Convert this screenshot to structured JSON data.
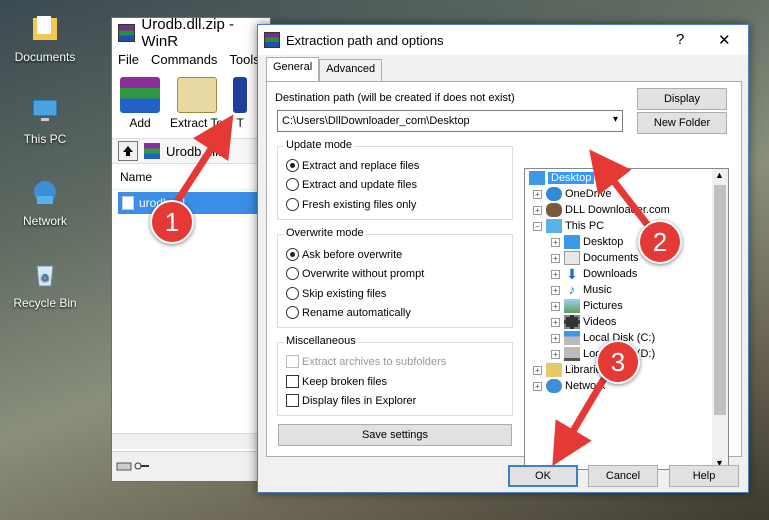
{
  "desktop": {
    "icons": [
      {
        "label": "Documents"
      },
      {
        "label": "This PC"
      },
      {
        "label": "Network"
      },
      {
        "label": "Recycle Bin"
      }
    ]
  },
  "winrar": {
    "title": "Urodb.dll.zip - WinR",
    "menu": [
      "File",
      "Commands",
      "Tools"
    ],
    "tools": [
      {
        "label": "Add",
        "icon": "add-archive-icon"
      },
      {
        "label": "Extract To",
        "icon": "extract-to-icon"
      },
      {
        "label": "T",
        "icon": "test-icon"
      }
    ],
    "path_text": "Urodb.dll.z",
    "column_name": "Name",
    "file_row": "urodb.dll"
  },
  "dialog": {
    "title": "Extraction path and options",
    "help_glyph": "?",
    "close_glyph": "✕",
    "tabs": [
      "General",
      "Advanced"
    ],
    "dest_label": "Destination path (will be created if does not exist)",
    "dest_value": "C:\\Users\\DllDownloader_com\\Desktop",
    "display_btn": "Display",
    "new_folder_btn": "New Folder",
    "update_mode": {
      "title": "Update mode",
      "options": [
        "Extract and replace files",
        "Extract and update files",
        "Fresh existing files only"
      ],
      "selected": 0
    },
    "overwrite_mode": {
      "title": "Overwrite mode",
      "options": [
        "Ask before overwrite",
        "Overwrite without prompt",
        "Skip existing files",
        "Rename automatically"
      ],
      "selected": 0
    },
    "misc": {
      "title": "Miscellaneous",
      "options": [
        "Extract archives to subfolders",
        "Keep broken files",
        "Display files in Explorer"
      ]
    },
    "save_settings": "Save settings",
    "tree": [
      {
        "label": "Desktop",
        "selected": true
      },
      {
        "label": "OneDrive"
      },
      {
        "label": "DLL Downloader.com"
      },
      {
        "label": "This PC"
      },
      {
        "label": "Desktop"
      },
      {
        "label": "Documents"
      },
      {
        "label": "Downloads"
      },
      {
        "label": "Music"
      },
      {
        "label": "Pictures"
      },
      {
        "label": "Videos"
      },
      {
        "label": "Local Disk (C:)"
      },
      {
        "label": "Local Disk (D:)"
      },
      {
        "label": "Libraries"
      },
      {
        "label": "Network"
      }
    ],
    "ok": "OK",
    "cancel": "Cancel",
    "help": "Help"
  },
  "callouts": [
    "1",
    "2",
    "3"
  ],
  "colors": {
    "accent": "#3399ff",
    "callout": "#e53935"
  }
}
